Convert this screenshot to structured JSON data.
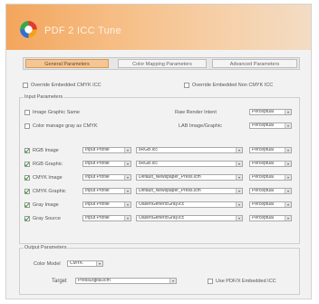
{
  "app": {
    "title": "PDF 2 ICC Tune"
  },
  "tabs": [
    {
      "label": "General Parameters",
      "active": true
    },
    {
      "label": "Color Mapping Parameters",
      "active": false
    },
    {
      "label": "Advanced Parameters",
      "active": false
    }
  ],
  "override": {
    "cmyk_label": "Override Embedded CMYK ICC",
    "cmyk_checked": false,
    "non_cmyk_label": "Override Embedded Non CMYK ICC",
    "non_cmyk_checked": false
  },
  "input_parameters": {
    "group_label": "Input Parameters",
    "image_graphic_same_label": "Image Graphic Same",
    "image_graphic_same_checked": false,
    "color_manage_gray_label": "Color manage gray as CMYK",
    "color_manage_gray_checked": false,
    "raw_render_intent_label": "Raw Render Intent",
    "raw_render_intent_value": "Perceptual",
    "lab_image_graphic_label": "LAB Image/Graphic",
    "lab_image_graphic_value": "Perceptual",
    "rows": [
      {
        "label": "RGB Image",
        "checked": true,
        "profile": "Input Profile",
        "icc": "sRGB.icc",
        "intent": "Perceptual"
      },
      {
        "label": "RGB Graphic",
        "checked": true,
        "profile": "Input Profile",
        "icc": "sRGB.icc",
        "intent": "Perceptual"
      },
      {
        "label": "CMYK Image",
        "checked": true,
        "profile": "Input Profile",
        "icc": "Default_Newspaper_Press.icm",
        "intent": "Perceptual"
      },
      {
        "label": "CMYK Graphic",
        "checked": true,
        "profile": "Input Profile",
        "icc": "Default_Newspaper_Press.icm",
        "intent": "Perceptual"
      },
      {
        "label": "Gray Image",
        "checked": true,
        "profile": "Input Profile",
        "icc": "OasenGenericGray.icc",
        "intent": "Perceptual"
      },
      {
        "label": "Gray Source",
        "checked": true,
        "profile": "Input Profile",
        "icc": "OasenGenericGray.icc",
        "intent": "Perceptual"
      }
    ]
  },
  "output_parameters": {
    "group_label": "Output Parameters",
    "color_model_label": "Color Model",
    "color_model_value": "CMYK",
    "target_label": "Target",
    "target_value": "PressDigital.icm",
    "use_pdfx_label": "Use PDF/X Embedded ICC",
    "use_pdfx_checked": false
  },
  "colors": {
    "banner_start": "#f3a55c",
    "active_tab": "#f5c594",
    "check_green": "#2e9a2e"
  },
  "icons": {
    "logo": "color-wheel-icon",
    "dropdown": "chevron-down-icon",
    "check": "checkmark-icon"
  }
}
